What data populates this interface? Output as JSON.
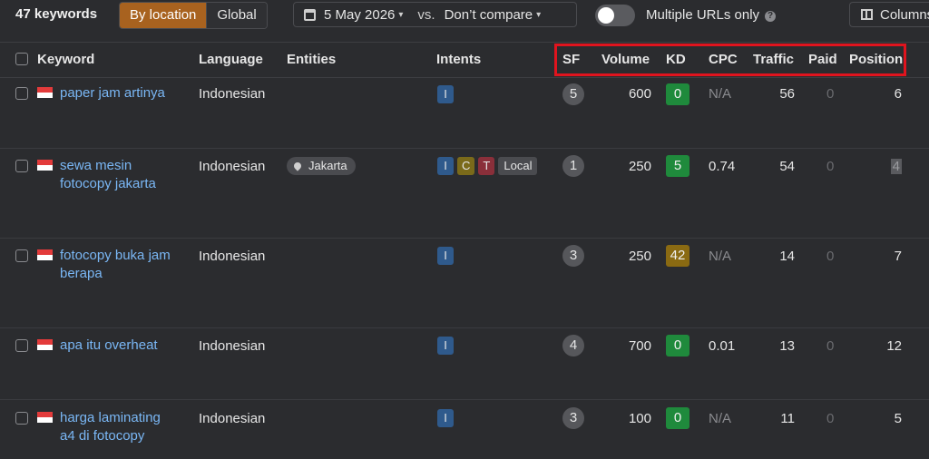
{
  "toolbar": {
    "keyword_count": "47 keywords",
    "by_location": "By location",
    "global": "Global",
    "date": "5 May 2026",
    "vs": "vs.",
    "compare": "Don’t compare",
    "multiple_urls": "Multiple URLs only",
    "columns": "Columns",
    "toggle_on": false
  },
  "table": {
    "headers": {
      "keyword": "Keyword",
      "language": "Language",
      "entities": "Entities",
      "intents": "Intents",
      "sf": "SF",
      "volume": "Volume",
      "kd": "KD",
      "cpc": "CPC",
      "traffic": "Traffic",
      "paid": "Paid",
      "position": "Position"
    },
    "rows": [
      {
        "keyword_line1": "paper jam artinya",
        "keyword_line2": "",
        "language": "Indonesian",
        "entity": "",
        "intents": [
          "I"
        ],
        "sf": "5",
        "volume": "600",
        "kd": "0",
        "kd_color": "#1f8a3c",
        "cpc": "N/A",
        "traffic": "56",
        "paid": "0",
        "position": "6"
      },
      {
        "keyword_line1": "sewa mesin",
        "keyword_line2": "fotocopy jakarta",
        "language": "Indonesian",
        "entity": "Jakarta",
        "intents": [
          "I",
          "C",
          "T",
          "Local"
        ],
        "sf": "1",
        "volume": "250",
        "kd": "5",
        "kd_color": "#1f8a3c",
        "cpc": "0.74",
        "traffic": "54",
        "paid": "0",
        "position": "4"
      },
      {
        "keyword_line1": "fotocopy buka jam",
        "keyword_line2": "berapa",
        "language": "Indonesian",
        "entity": "",
        "intents": [
          "I"
        ],
        "sf": "3",
        "volume": "250",
        "kd": "42",
        "kd_color": "#8a6a12",
        "cpc": "N/A",
        "traffic": "14",
        "paid": "0",
        "position": "7"
      },
      {
        "keyword_line1": "apa itu overheat",
        "keyword_line2": "",
        "language": "Indonesian",
        "entity": "",
        "intents": [
          "I"
        ],
        "sf": "4",
        "volume": "700",
        "kd": "0",
        "kd_color": "#1f8a3c",
        "cpc": "0.01",
        "traffic": "13",
        "paid": "0",
        "position": "12"
      },
      {
        "keyword_line1": "harga laminating",
        "keyword_line2": "a4 di fotocopy",
        "language": "Indonesian",
        "entity": "",
        "intents": [
          "I"
        ],
        "sf": "3",
        "volume": "100",
        "kd": "0",
        "kd_color": "#1f8a3c",
        "cpc": "N/A",
        "traffic": "11",
        "paid": "0",
        "position": "5"
      }
    ]
  },
  "colors": {
    "background": "#2b2c2f",
    "link": "#7ab7f5",
    "accent": "#a8621f",
    "highlight_box": "#e0141e"
  }
}
